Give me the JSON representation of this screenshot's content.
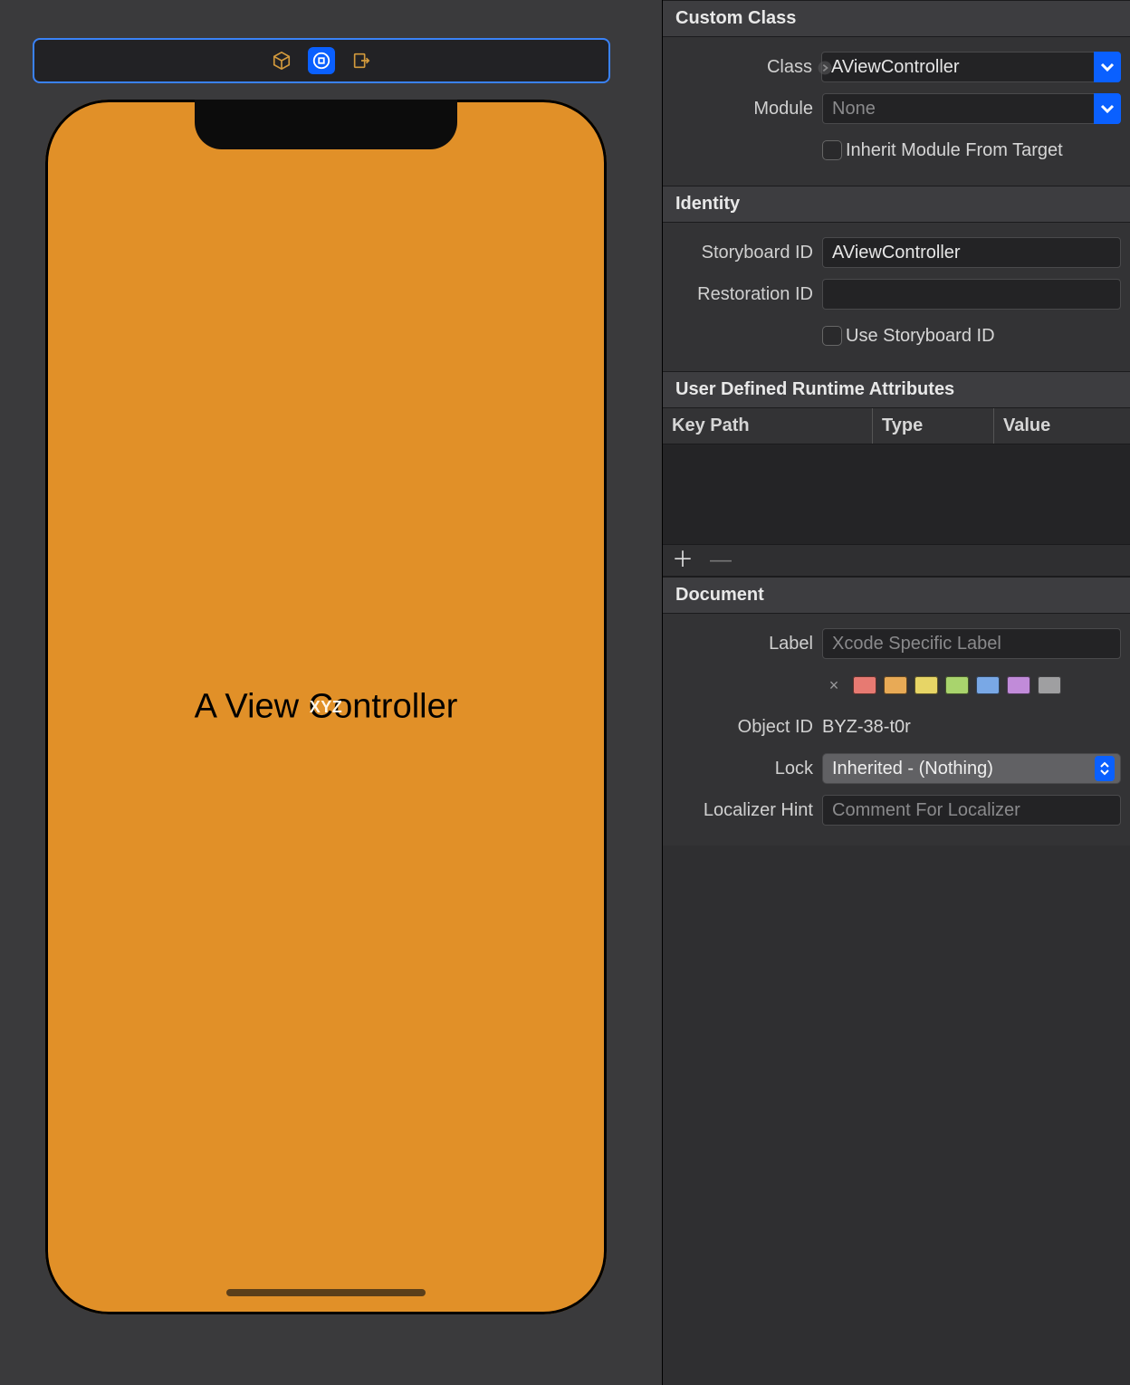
{
  "canvas": {
    "label_text": "A View Controller",
    "overlay_text": "XYZ"
  },
  "custom_class": {
    "header": "Custom Class",
    "class_label": "Class",
    "class_value": "AViewController",
    "module_label": "Module",
    "module_value": "",
    "module_placeholder": "None",
    "inherit_label": "Inherit Module From Target"
  },
  "identity": {
    "header": "Identity",
    "storyboard_id_label": "Storyboard ID",
    "storyboard_id_value": "AViewController",
    "restoration_id_label": "Restoration ID",
    "restoration_id_value": "",
    "use_storyboard_id_label": "Use Storyboard ID"
  },
  "runtime_attrs": {
    "header": "User Defined Runtime Attributes",
    "col_keypath": "Key Path",
    "col_type": "Type",
    "col_value": "Value"
  },
  "document": {
    "header": "Document",
    "label_label": "Label",
    "label_placeholder": "Xcode Specific Label",
    "object_id_label": "Object ID",
    "object_id_value": "BYZ-38-t0r",
    "lock_label": "Lock",
    "lock_value": "Inherited - (Nothing)",
    "localizer_hint_label": "Localizer Hint",
    "localizer_hint_placeholder": "Comment For Localizer",
    "colors": [
      "#e77a72",
      "#e8aa56",
      "#e7d566",
      "#a9d46d",
      "#79a8e6",
      "#c18bd9",
      "#9f9fa1"
    ]
  }
}
